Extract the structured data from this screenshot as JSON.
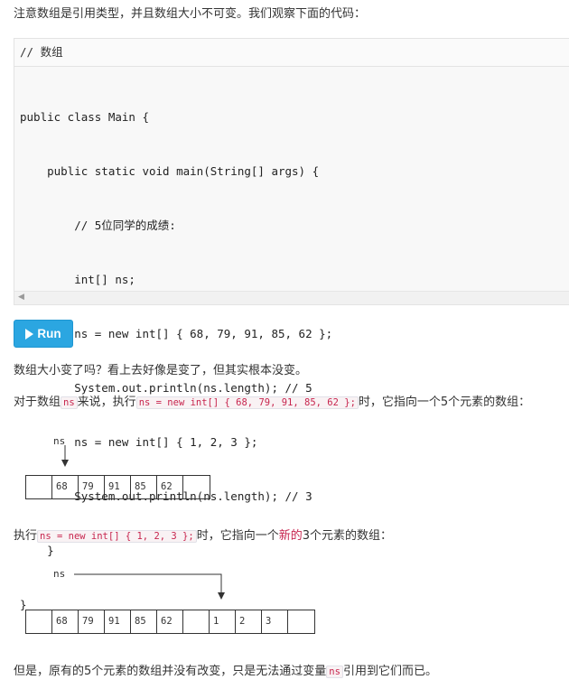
{
  "intro": "注意数组是引用类型，并且数组大小不可变。我们观察下面的代码：",
  "code": {
    "header": "// 数组",
    "lines": [
      "public class Main {",
      "    public static void main(String[] args) {",
      "        // 5位同学的成绩:",
      "        int[] ns;",
      "        ns = new int[] { 68, 79, 91, 85, 62 };",
      "        System.out.println(ns.length); // 5",
      "        ns = new int[] { 1, 2, 3 };",
      "        System.out.println(ns.length); // 3",
      "    }",
      "}"
    ]
  },
  "run_button": {
    "label": "Run",
    "icon": "play-icon",
    "color": "#2ba6e1"
  },
  "para1": "数组大小变了吗？看上去好像是变了，但其实根本没变。",
  "para2": {
    "prefix": "对于数组",
    "var": "ns",
    "mid": "来说，执行",
    "code": "ns = new int[] { 68, 79, 91, 85, 62 };",
    "suffix": "时，它指向一个5个元素的数组："
  },
  "diagram1": {
    "pointer_label": "ns",
    "cells": [
      "",
      "68",
      "79",
      "91",
      "85",
      "62",
      ""
    ]
  },
  "para3": {
    "prefix": "执行",
    "code": "ns = new int[] { 1, 2, 3 };",
    "mid": "时，它指向一个",
    "highlight": "新的",
    "suffix": "3个元素的数组："
  },
  "diagram2": {
    "pointer_label": "ns",
    "cells": [
      "",
      "68",
      "79",
      "91",
      "85",
      "62",
      "",
      "1",
      "2",
      "3",
      ""
    ]
  },
  "para4": {
    "prefix": "但是，原有的5个元素的数组并没有改变，只是无法通过变量",
    "var": "ns",
    "suffix": "引用到它们而已。"
  }
}
